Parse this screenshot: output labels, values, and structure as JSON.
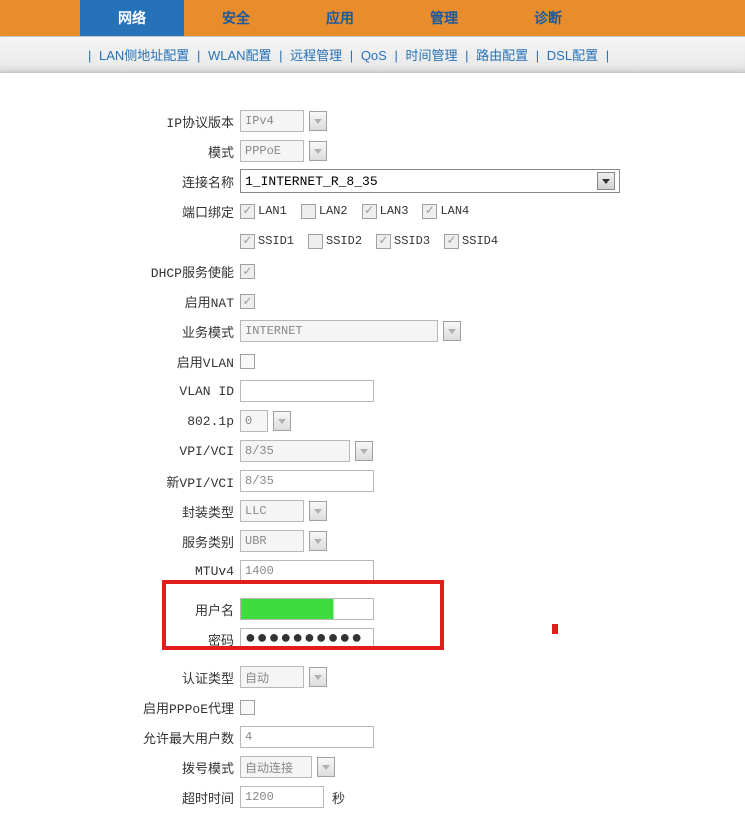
{
  "topTabs": {
    "network": "网络",
    "security": "安全",
    "app": "应用",
    "manage": "管理",
    "diag": "诊断"
  },
  "subMenu": {
    "lan": "LAN侧地址配置",
    "wlan": "WLAN配置",
    "remote": "远程管理",
    "qos": "QoS",
    "time": "时间管理",
    "route": "路由配置",
    "dsl": "DSL配置"
  },
  "labels": {
    "ipVer": "IP协议版本",
    "mode": "模式",
    "connName": "连接名称",
    "portBind": "端口绑定",
    "dhcp": "DHCP服务使能",
    "nat": "启用NAT",
    "svcMode": "业务模式",
    "vlan": "启用VLAN",
    "vlanId": "VLAN ID",
    "p8021": "802.1p",
    "vpiVci": "VPI/VCI",
    "newVpiVci": "新VPI/VCI",
    "encap": "封装类型",
    "svcCat": "服务类别",
    "mtu": "MTUv4",
    "user": "用户名",
    "pwd": "密码",
    "auth": "认证类型",
    "pppoeProxy": "启用PPPoE代理",
    "maxUsers": "允许最大用户数",
    "dialMode": "拨号模式",
    "timeout": "超时时间"
  },
  "values": {
    "ipVer": "IPv4",
    "mode": "PPPoE",
    "connName": "1_INTERNET_R_8_35",
    "svcMode": "INTERNET",
    "vlanId": "",
    "p8021": "0",
    "vpiVci": "8/35",
    "newVpiVci": "8/35",
    "encap": "LLC",
    "svcCat": "UBR",
    "mtu": "1400",
    "user": "",
    "pwd": "●●●●●●●●●●",
    "auth": "自动",
    "maxUsers": "4",
    "dialMode": "自动连接",
    "timeout": "1200"
  },
  "ports": {
    "lan1": "LAN1",
    "lan2": "LAN2",
    "lan3": "LAN3",
    "lan4": "LAN4",
    "ssid1": "SSID1",
    "ssid2": "SSID2",
    "ssid3": "SSID3",
    "ssid4": "SSID4"
  },
  "units": {
    "sec": "秒"
  }
}
